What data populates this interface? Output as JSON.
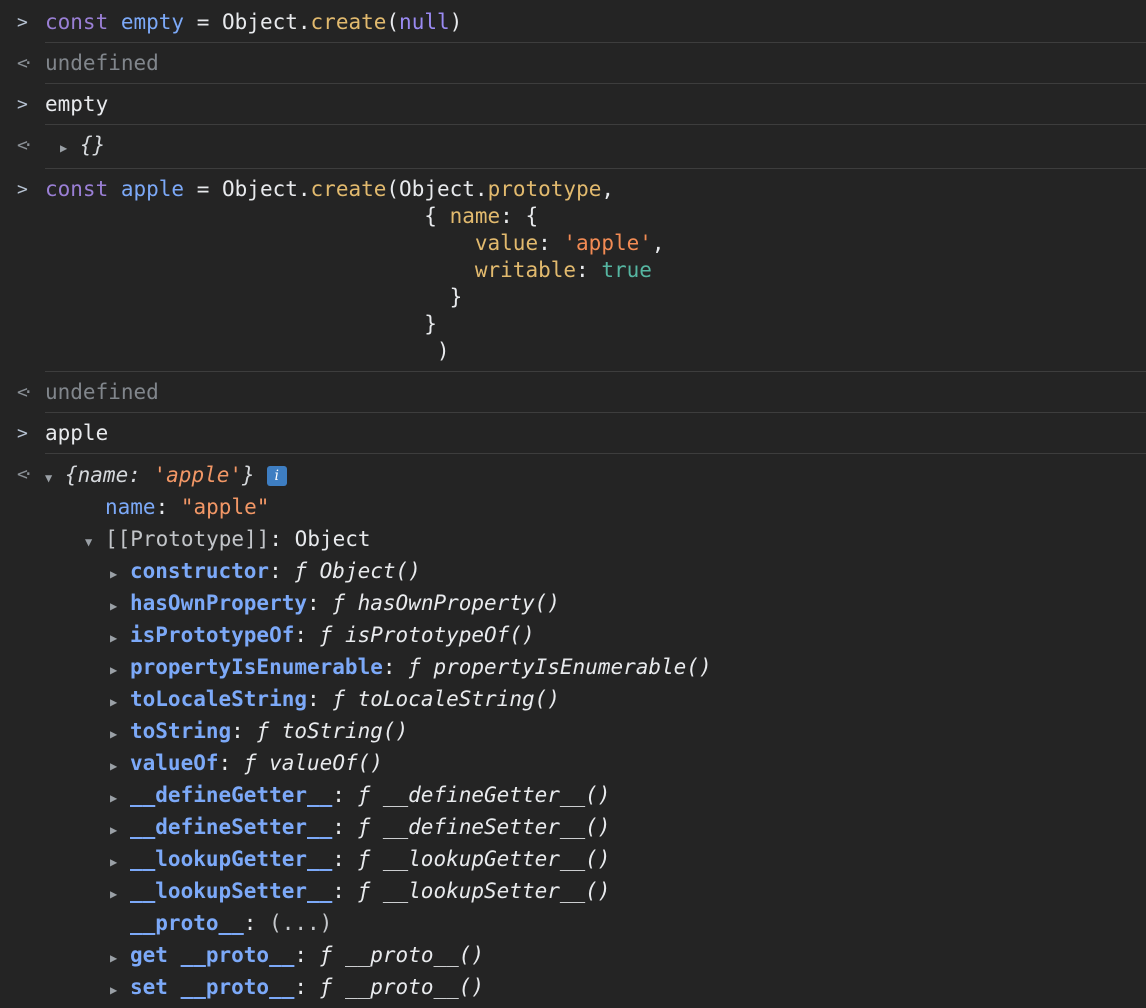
{
  "theme": {
    "background": "#242424",
    "divider": "#3d3d3d",
    "text": "#e8eaed",
    "muted_text": "#81868c",
    "keyword": "#9a7fd5",
    "variable": "#7ca9f8",
    "property": "#e2ba6e",
    "string_input": "#f28b54",
    "string_output": "#f29766",
    "atom": "#9a8af2",
    "boolean": "#56b6a2",
    "function_name": "#7ca9f8",
    "object_preview": "#d5d8dc",
    "info_badge": "#3e7ec2",
    "triangle": "#9aa0a6"
  },
  "console": {
    "entries": [
      {
        "kind": "input",
        "gutter": ">",
        "rows": [
          {
            "tokens": [
              {
                "t": "const ",
                "c": "kw"
              },
              {
                "t": "empty",
                "c": "var"
              },
              {
                "t": " = ",
                "c": "pl"
              },
              {
                "t": "Object.",
                "c": "pl"
              },
              {
                "t": "create",
                "c": "prop"
              },
              {
                "t": "(",
                "c": "pl"
              },
              {
                "t": "null",
                "c": "atom"
              },
              {
                "t": ")",
                "c": "pl"
              }
            ]
          }
        ]
      },
      {
        "kind": "result",
        "gutter": "<·",
        "rows": [
          {
            "tokens": [
              {
                "t": "undefined",
                "c": "muted"
              }
            ]
          }
        ]
      },
      {
        "kind": "input",
        "gutter": ">",
        "rows": [
          {
            "tokens": [
              {
                "t": "empty",
                "c": "pl"
              }
            ]
          }
        ]
      },
      {
        "kind": "result",
        "gutter": "<·",
        "rows": [
          {
            "indent": 15,
            "arrow": "right",
            "tokens": [
              {
                "t": "{}",
                "c": "objprev"
              }
            ]
          }
        ]
      },
      {
        "kind": "input",
        "gutter": ">",
        "rows": [
          {
            "tokens": [
              {
                "t": "const ",
                "c": "kw"
              },
              {
                "t": "apple",
                "c": "var"
              },
              {
                "t": " = ",
                "c": "pl"
              },
              {
                "t": "Object.",
                "c": "pl"
              },
              {
                "t": "create",
                "c": "prop"
              },
              {
                "t": "(",
                "c": "pl"
              },
              {
                "t": "Object.",
                "c": "pl"
              },
              {
                "t": "prototype",
                "c": "prop"
              },
              {
                "t": ",",
                "c": "pl"
              }
            ]
          },
          {
            "tokens": [
              {
                "t": "                              { ",
                "c": "pl"
              },
              {
                "t": "name",
                "c": "prop"
              },
              {
                "t": ": {",
                "c": "pl"
              }
            ]
          },
          {
            "tokens": [
              {
                "t": "                                  ",
                "c": "pl"
              },
              {
                "t": "value",
                "c": "prop"
              },
              {
                "t": ": ",
                "c": "pl"
              },
              {
                "t": "'apple'",
                "c": "str"
              },
              {
                "t": ",",
                "c": "pl"
              }
            ]
          },
          {
            "tokens": [
              {
                "t": "                                  ",
                "c": "pl"
              },
              {
                "t": "writable",
                "c": "prop"
              },
              {
                "t": ": ",
                "c": "pl"
              },
              {
                "t": "true",
                "c": "bool"
              }
            ]
          },
          {
            "tokens": [
              {
                "t": "                                }",
                "c": "pl"
              }
            ]
          },
          {
            "tokens": [
              {
                "t": "                              }",
                "c": "pl"
              }
            ]
          },
          {
            "tokens": [
              {
                "t": "                               )",
                "c": "pl"
              }
            ]
          }
        ]
      },
      {
        "kind": "result",
        "gutter": "<·",
        "rows": [
          {
            "tokens": [
              {
                "t": "undefined",
                "c": "muted"
              }
            ]
          }
        ]
      },
      {
        "kind": "input",
        "gutter": ">",
        "rows": [
          {
            "tokens": [
              {
                "t": "apple",
                "c": "pl"
              }
            ]
          }
        ]
      },
      {
        "kind": "tree",
        "gutter": "<·",
        "rows": [
          {
            "indent": 0,
            "arrow": "down",
            "icon": "info",
            "tokens": [
              {
                "t": "{name: ",
                "c": "objprev"
              },
              {
                "t": "'apple'",
                "c": "prevstr"
              },
              {
                "t": "}",
                "c": "objprev"
              }
            ]
          },
          {
            "indent": 60,
            "tokens": [
              {
                "t": "name",
                "c": "key"
              },
              {
                "t": ": ",
                "c": "pl"
              },
              {
                "t": "\"apple\"",
                "c": "vstr"
              }
            ]
          },
          {
            "indent": 40,
            "arrow": "down",
            "tokens": [
              {
                "t": "[[Prototype]]",
                "c": "internal"
              },
              {
                "t": ": ",
                "c": "pl"
              },
              {
                "t": "Object",
                "c": "pl"
              }
            ]
          },
          {
            "indent": 65,
            "arrow": "right",
            "tokens": [
              {
                "t": "constructor",
                "c": "fname"
              },
              {
                "t": ": ",
                "c": "pl"
              },
              {
                "t": "ƒ Object()",
                "c": "fval"
              }
            ]
          },
          {
            "indent": 65,
            "arrow": "right",
            "tokens": [
              {
                "t": "hasOwnProperty",
                "c": "fname"
              },
              {
                "t": ": ",
                "c": "pl"
              },
              {
                "t": "ƒ hasOwnProperty()",
                "c": "fval"
              }
            ]
          },
          {
            "indent": 65,
            "arrow": "right",
            "tokens": [
              {
                "t": "isPrototypeOf",
                "c": "fname"
              },
              {
                "t": ": ",
                "c": "pl"
              },
              {
                "t": "ƒ isPrototypeOf()",
                "c": "fval"
              }
            ]
          },
          {
            "indent": 65,
            "arrow": "right",
            "tokens": [
              {
                "t": "propertyIsEnumerable",
                "c": "fname"
              },
              {
                "t": ": ",
                "c": "pl"
              },
              {
                "t": "ƒ propertyIsEnumerable()",
                "c": "fval"
              }
            ]
          },
          {
            "indent": 65,
            "arrow": "right",
            "tokens": [
              {
                "t": "toLocaleString",
                "c": "fname"
              },
              {
                "t": ": ",
                "c": "pl"
              },
              {
                "t": "ƒ toLocaleString()",
                "c": "fval"
              }
            ]
          },
          {
            "indent": 65,
            "arrow": "right",
            "tokens": [
              {
                "t": "toString",
                "c": "fname"
              },
              {
                "t": ": ",
                "c": "pl"
              },
              {
                "t": "ƒ toString()",
                "c": "fval"
              }
            ]
          },
          {
            "indent": 65,
            "arrow": "right",
            "tokens": [
              {
                "t": "valueOf",
                "c": "fname"
              },
              {
                "t": ": ",
                "c": "pl"
              },
              {
                "t": "ƒ valueOf()",
                "c": "fval"
              }
            ]
          },
          {
            "indent": 65,
            "arrow": "right",
            "tokens": [
              {
                "t": "__defineGetter__",
                "c": "fname"
              },
              {
                "t": ": ",
                "c": "pl"
              },
              {
                "t": "ƒ __defineGetter__()",
                "c": "fval"
              }
            ]
          },
          {
            "indent": 65,
            "arrow": "right",
            "tokens": [
              {
                "t": "__defineSetter__",
                "c": "fname"
              },
              {
                "t": ": ",
                "c": "pl"
              },
              {
                "t": "ƒ __defineSetter__()",
                "c": "fval"
              }
            ]
          },
          {
            "indent": 65,
            "arrow": "right",
            "tokens": [
              {
                "t": "__lookupGetter__",
                "c": "fname"
              },
              {
                "t": ": ",
                "c": "pl"
              },
              {
                "t": "ƒ __lookupGetter__()",
                "c": "fval"
              }
            ]
          },
          {
            "indent": 65,
            "arrow": "right",
            "tokens": [
              {
                "t": "__lookupSetter__",
                "c": "fname"
              },
              {
                "t": ": ",
                "c": "pl"
              },
              {
                "t": "ƒ __lookupSetter__()",
                "c": "fval"
              }
            ]
          },
          {
            "indent": 85,
            "tokens": [
              {
                "t": "__proto__",
                "c": "fname"
              },
              {
                "t": ": ",
                "c": "pl"
              },
              {
                "t": "(...)",
                "c": "expander"
              }
            ]
          },
          {
            "indent": 65,
            "arrow": "right",
            "tokens": [
              {
                "t": "get __proto__",
                "c": "fname"
              },
              {
                "t": ": ",
                "c": "pl"
              },
              {
                "t": "ƒ __proto__()",
                "c": "fval"
              }
            ]
          },
          {
            "indent": 65,
            "arrow": "right",
            "tokens": [
              {
                "t": "set __proto__",
                "c": "fname"
              },
              {
                "t": ": ",
                "c": "pl"
              },
              {
                "t": "ƒ __proto__()",
                "c": "fval"
              }
            ]
          }
        ]
      }
    ]
  }
}
